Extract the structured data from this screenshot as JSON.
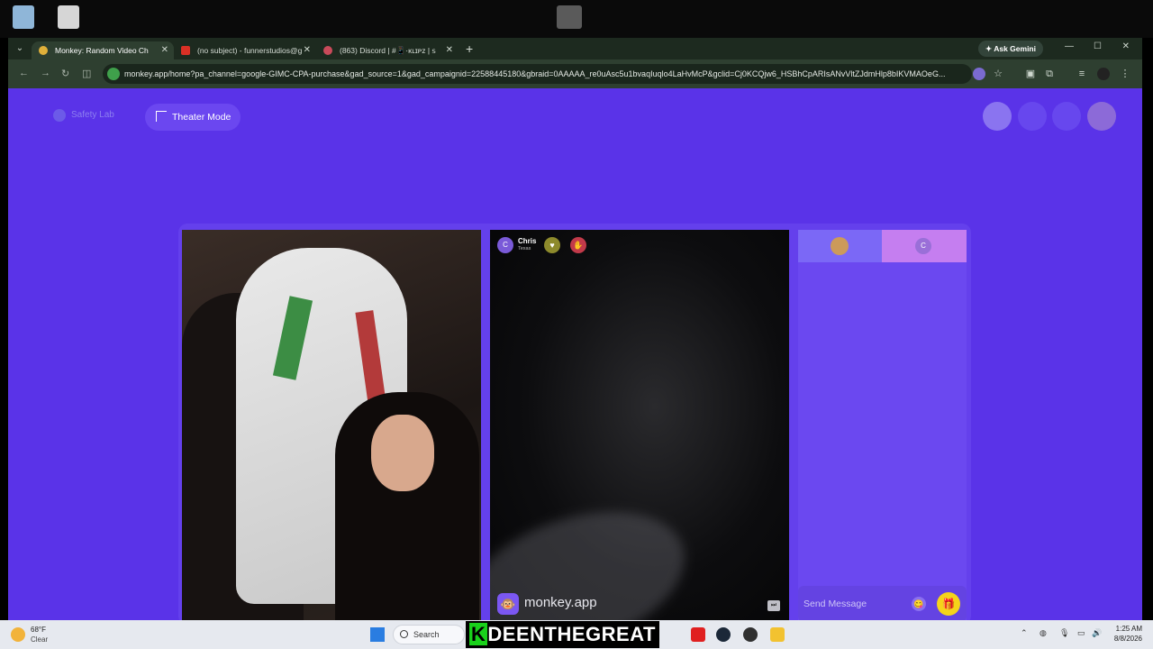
{
  "browser": {
    "tabs": [
      {
        "label": "Monkey: Random Video Ch",
        "favicon_color": "#e0b03a",
        "active": true
      },
      {
        "label": "(no subject) - funnerstudios@g",
        "favicon_color": "#d93025",
        "active": false
      },
      {
        "label": "(863) Discord | #📱·ᴋʟɪᴘᴢ | ꜱ",
        "favicon_color": "#5865f2",
        "active": false
      }
    ],
    "new_tab": "+",
    "gemini_label": "Ask Gemini",
    "url": "monkey.app/home?pa_channel=google-GIMC-CPA-purchase&gad_source=1&gad_campaignid=22588445180&gbraid=0AAAAA_re0uAsc5u1bvaqIuqlo4LaHvMcP&gclid=Cj0KCQjw6_HSBhCpARIsANvVltZJdmHlp8bIKVMAOeG..."
  },
  "page": {
    "safety_lab": "Safety Lab",
    "theater_mode": "Theater Mode",
    "remote_user": {
      "initial": "C",
      "name": "Chris",
      "location": "Texas"
    },
    "brand_text": "monkey.app",
    "brand_emoji": "🐵",
    "chat": {
      "tab_user_initial": "C",
      "placeholder": "Send Message",
      "emoji": "😋",
      "gift": "🎁"
    }
  },
  "taskbar": {
    "temp": "68°F",
    "condition": "Clear",
    "search": "Search",
    "overlay_k": "K",
    "overlay_rest": "DEENTHEGREAT",
    "time": "1:25 AM",
    "date": "8/8/2026"
  },
  "colors": {
    "page_bg": "#5a33e8",
    "accent_gold": "#f5d31a"
  }
}
